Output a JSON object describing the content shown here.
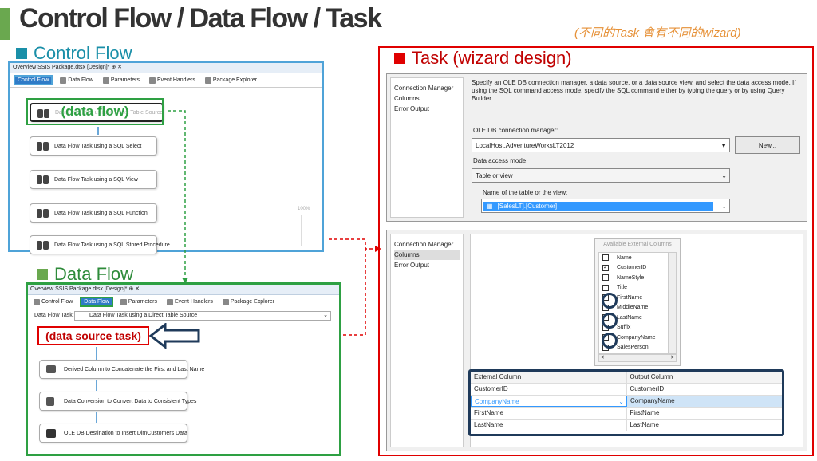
{
  "header": {
    "title": "Control Flow / Data Flow / Task",
    "note": "(不同的Task 會有不同的wizard)"
  },
  "control_flow": {
    "heading": "Control Flow",
    "window_title": "Overview SSIS Package.dtsx [Design]* ⊕ ✕",
    "tabs": [
      "Control Flow",
      "Data Flow",
      "Parameters",
      "Event Handlers",
      "Package Explorer"
    ],
    "overlay_label": "(data flow)",
    "tasks": [
      "Data Flow Task using a Direct Table Source",
      "Data Flow Task using a SQL Select",
      "Data Flow Task using a SQL View",
      "Data Flow Task using a SQL Function",
      "Data Flow Task using a SQL Stored Procedure"
    ],
    "zoom": "100%"
  },
  "data_flow": {
    "heading": "Data Flow",
    "window_title": "Overview SSIS Package.dtsx [Design]* ⊕ ✕",
    "tabs": [
      "Control Flow",
      "Data Flow",
      "Parameters",
      "Event Handlers",
      "Package Explorer"
    ],
    "task_label": "Data Flow Task:",
    "task_value": "Data Flow Task using a Direct Table Source",
    "overlay_label": "(data source task)",
    "steps": [
      "Derived Column to Concatenate the First and Last Name",
      "Data Conversion to Convert Data to Consistent Types",
      "OLE DB Destination to Insert DimCustomers Data"
    ]
  },
  "task_wizard": {
    "heading": "Task (wizard design)",
    "sidebar": [
      "Connection Manager",
      "Columns",
      "Error Output"
    ],
    "description": "Specify an OLE DB connection manager, a data source, or a data source view, and select the data access mode. If using the SQL command access mode, specify the SQL command either by typing the query or by using Query Builder.",
    "conn_label": "OLE DB connection manager:",
    "conn_value": "LocalHost.AdventureWorksLT2012",
    "new_button": "New...",
    "access_label": "Data access mode:",
    "access_value": "Table or view",
    "table_label": "Name of the table or the view:",
    "table_value": "[SalesLT].[Customer]"
  },
  "columns_panel": {
    "sidebar": [
      "Connection Manager",
      "Columns",
      "Error Output"
    ],
    "avail_title": "Available External Columns",
    "columns": [
      {
        "name": "Name",
        "checked": false
      },
      {
        "name": "CustomerID",
        "checked": true
      },
      {
        "name": "NameStyle",
        "checked": false
      },
      {
        "name": "Title",
        "checked": false
      },
      {
        "name": "FirstName",
        "checked": true
      },
      {
        "name": "MiddleName",
        "checked": false
      },
      {
        "name": "LastName",
        "checked": true
      },
      {
        "name": "Suffix",
        "checked": false
      },
      {
        "name": "CompanyName",
        "checked": true
      },
      {
        "name": "SalesPerson",
        "checked": false
      }
    ],
    "grid_headers": [
      "External Column",
      "Output Column"
    ],
    "grid_rows": [
      [
        "CustomerID",
        "CustomerID"
      ],
      [
        "CompanyName",
        "CompanyName"
      ],
      [
        "FirstName",
        "FirstName"
      ],
      [
        "LastName",
        "LastName"
      ]
    ]
  },
  "colors": {
    "green": "#6aa84f",
    "teal": "#1a8fa8",
    "red": "#e00000",
    "blue_border": "#4fa3d8",
    "dark_border": "#1f3a5a"
  }
}
